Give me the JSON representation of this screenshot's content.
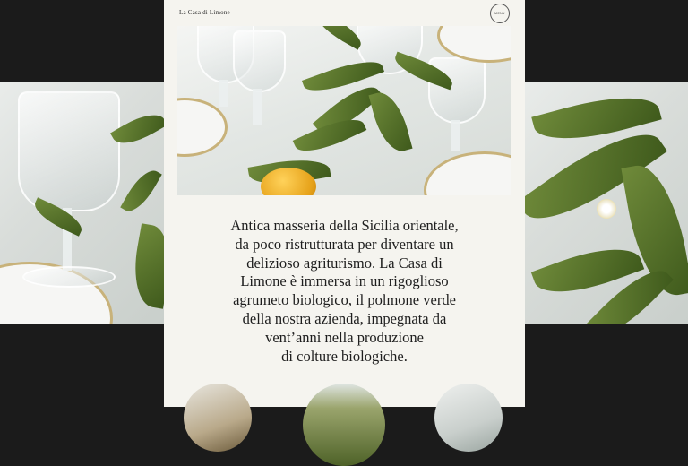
{
  "header": {
    "brand": "La Casa di Limone",
    "menu_label": "MENU"
  },
  "intro": {
    "lines": [
      "Antica masseria della Sicilia orientale,",
      "da poco ristrutturata per diventare un",
      "delizioso agriturismo. La Casa di",
      "Limone è immersa in un rigoglioso",
      "agrumeto biologico, il polmone verde",
      "della nostra azienda, impegnata da",
      "vent’anni nella produzione",
      "di colture biologiche."
    ]
  },
  "colors": {
    "backdrop": "#1b1b1b",
    "column_bg": "#f5f4ef",
    "text": "#1e1e1e",
    "leaf_green": "#4f6b26",
    "lemon_yellow": "#f0b021"
  }
}
